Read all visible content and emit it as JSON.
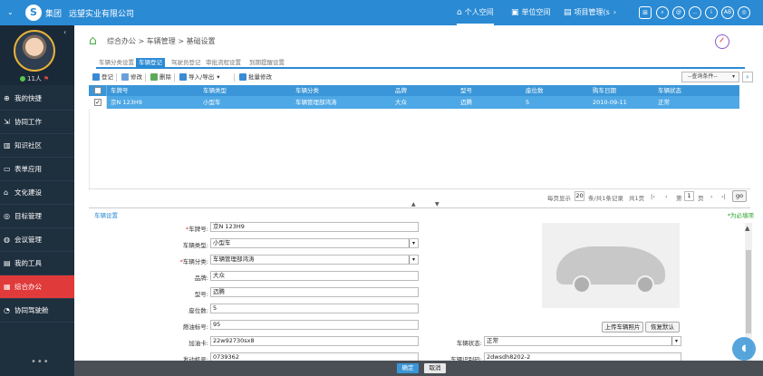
{
  "topbar": {
    "group_label": "集团",
    "company": "远望实业有限公司",
    "nav": [
      {
        "label": "个人空间",
        "icon": "home-icon",
        "active": true
      },
      {
        "label": "单位空间",
        "icon": "bus-icon",
        "active": false
      },
      {
        "label": "项目管理(s",
        "icon": "project-icon",
        "active": false
      }
    ],
    "icons": [
      "apps-icon",
      "search-icon",
      "at-icon",
      "chat-icon",
      "info-icon",
      "avatar-ab-icon",
      "settings-icon"
    ],
    "ab_text": "AB",
    "accent_color": "#2a8ad4"
  },
  "sidebar": {
    "online_count": "11人",
    "items": [
      {
        "label": "我的快捷",
        "icon": "plus-circle-icon"
      },
      {
        "label": "协同工作",
        "icon": "share-icon"
      },
      {
        "label": "知识社区",
        "icon": "book-icon"
      },
      {
        "label": "表单应用",
        "icon": "form-icon"
      },
      {
        "label": "文化建设",
        "icon": "building-icon"
      },
      {
        "label": "目标管理",
        "icon": "target-icon"
      },
      {
        "label": "会议管理",
        "icon": "meeting-icon"
      },
      {
        "label": "我的工具",
        "icon": "toolbox-icon"
      },
      {
        "label": "综合办公",
        "icon": "office-icon",
        "active": true
      },
      {
        "label": "协同驾驶舱",
        "icon": "gauge-icon"
      }
    ],
    "more": "•••"
  },
  "breadcrumb": "综合办公 > 车辆管理 > 基础设置",
  "tabs": [
    {
      "label": "车辆分类设置",
      "active": false
    },
    {
      "label": "车辆登记",
      "active": true
    },
    {
      "label": "驾驶员登记",
      "active": false
    },
    {
      "label": "审批流程设置",
      "active": false
    },
    {
      "label": "到期提醒设置",
      "active": false
    }
  ],
  "toolbar": {
    "register": "登记",
    "edit": "修改",
    "delete": "删除",
    "import_export": "导入/导出",
    "batch_edit": "批量修改",
    "query_placeholder": "--查询条件--"
  },
  "grid": {
    "columns": [
      "车牌号",
      "车辆类型",
      "车辆分类",
      "品牌",
      "型号",
      "座位数",
      "购车日期",
      "车辆状态"
    ],
    "rows": [
      {
        "checked": true,
        "cells": [
          "京N 123H9",
          "小型车",
          "车辆管理部鸿涛",
          "大众",
          "迈腾",
          "5",
          "2010-09-11",
          "正常"
        ]
      }
    ]
  },
  "pager": {
    "per_page_label": "每页显示",
    "per_page": "20",
    "summary": "条/共1条记录",
    "pages": "共1页",
    "page_prefix": "第",
    "page": "1",
    "page_suffix": "页",
    "go": "go"
  },
  "form": {
    "section_title": "车辆设置",
    "required_note": "*为必填项",
    "fields": {
      "plate": {
        "label": "车牌号:",
        "value": "京N 123H9",
        "required": true
      },
      "type": {
        "label": "车辆类型:",
        "value": "小型车"
      },
      "category": {
        "label": "车辆分类:",
        "value": "车辆管理部鸿涛",
        "required": true
      },
      "brand": {
        "label": "品牌:",
        "value": "大众"
      },
      "model": {
        "label": "型号:",
        "value": "迈腾"
      },
      "seats": {
        "label": "座位数:",
        "value": "5"
      },
      "fuel": {
        "label": "燃油标号:",
        "value": "95"
      },
      "fuel_card": {
        "label": "加油卡:",
        "value": "22w92730sx8"
      },
      "engine": {
        "label": "发动机号:",
        "value": "0739362"
      },
      "status": {
        "label": "车辆状态:",
        "value": "正常"
      },
      "vin": {
        "label": "车辆识别码:",
        "value": "2dwsdh8202-2"
      }
    },
    "upload_photo": "上传车辆照片",
    "restore_default": "恢复默认"
  },
  "footer": {
    "confirm": "确定",
    "cancel": "取消"
  }
}
